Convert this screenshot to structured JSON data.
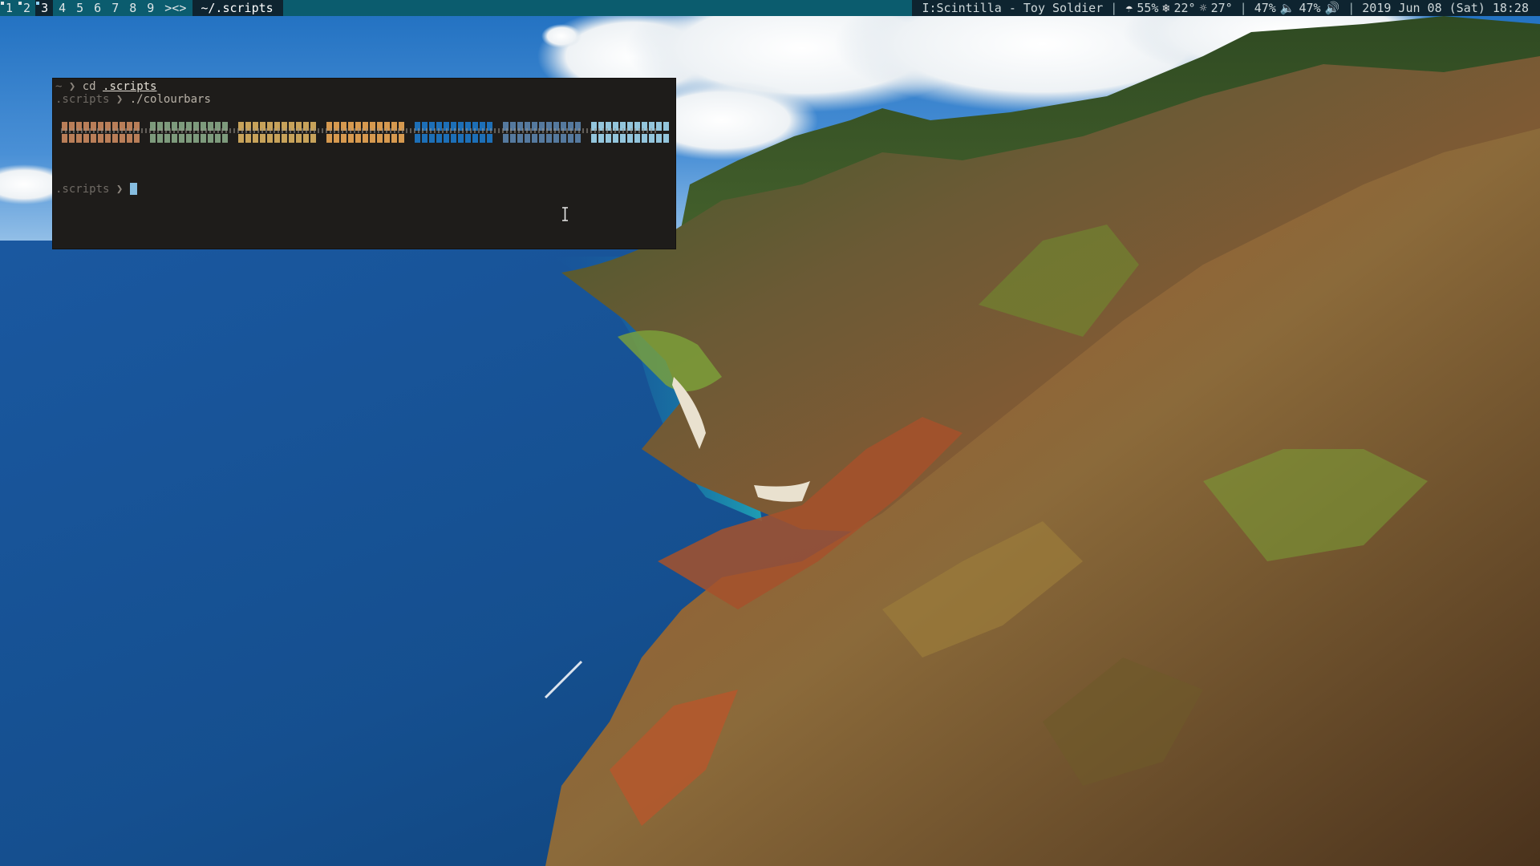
{
  "topbar": {
    "workspaces": [
      {
        "label": "1",
        "occupied": true,
        "focused": false
      },
      {
        "label": "2",
        "occupied": true,
        "focused": false
      },
      {
        "label": "3",
        "occupied": true,
        "focused": true
      },
      {
        "label": "4",
        "occupied": false,
        "focused": false
      },
      {
        "label": "5",
        "occupied": false,
        "focused": false
      },
      {
        "label": "6",
        "occupied": false,
        "focused": false
      },
      {
        "label": "7",
        "occupied": false,
        "focused": false
      },
      {
        "label": "8",
        "occupied": false,
        "focused": false
      },
      {
        "label": "9",
        "occupied": false,
        "focused": false
      }
    ],
    "layout_label": "><>",
    "window_title": "~/.scripts",
    "status": {
      "now_playing": "I:Scintilla - Toy Soldier",
      "humidity_icon": "umbrella-icon",
      "humidity": "55%",
      "snow_icon": "snowflake-icon",
      "temp_low": "22°",
      "sun_icon": "sun-icon",
      "temp_high": "27°",
      "brightness": "47%",
      "volume_low_icon": "volume-low-icon",
      "volume": "47%",
      "volume_high_icon": "volume-high-icon",
      "datetime": "2019 Jun 08 (Sat) 18:28"
    }
  },
  "terminal": {
    "line1": {
      "prompt_dir": "~",
      "arrow": "❯",
      "command": "cd",
      "arg": ".scripts"
    },
    "line2": {
      "prompt_dir": ".scripts",
      "arrow": "❯",
      "command": "./colourbars"
    },
    "colour_bars": [
      {
        "name": "orange-brown",
        "color": "#b97e58"
      },
      {
        "name": "sage-green",
        "color": "#7d9a7c"
      },
      {
        "name": "mustard",
        "color": "#c7a25a"
      },
      {
        "name": "amber",
        "color": "#d6994f"
      },
      {
        "name": "blue",
        "color": "#1d6fb7"
      },
      {
        "name": "slate-blue",
        "color": "#55799e"
      },
      {
        "name": "light-blue",
        "color": "#93c5dc"
      }
    ],
    "line3": {
      "prompt_dir": ".scripts",
      "arrow": "❯"
    }
  },
  "colors": {
    "bar_bg": "#0b5c6e",
    "bar_dark": "#0e2430",
    "terminal_bg": "#1e1c1a",
    "cursor": "#86bde0"
  }
}
